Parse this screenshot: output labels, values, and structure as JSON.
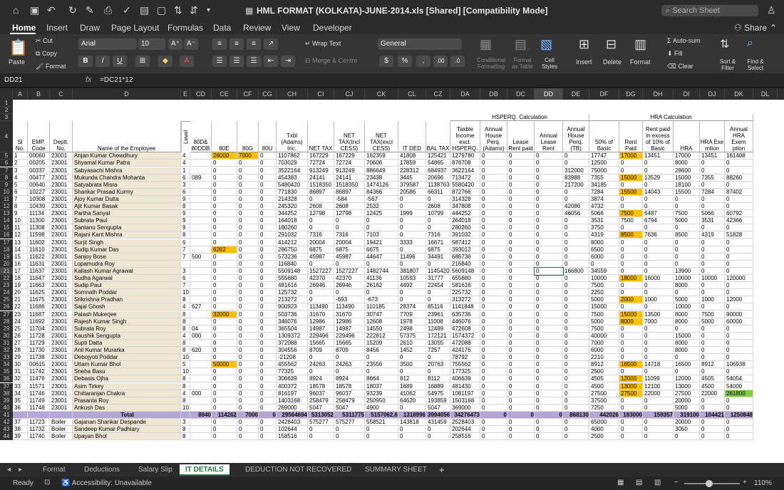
{
  "window": {
    "title": "HML FORMAT (KOLKATA)-JUNE-2014.xls  [Shared]  [Compatibility Mode]",
    "search_placeholder": "Search Sheet",
    "share": "Share"
  },
  "menu": [
    "Home",
    "Insert",
    "Draw",
    "Page Layout",
    "Formulas",
    "Data",
    "Review",
    "View",
    "Developer"
  ],
  "ribbon": {
    "paste": "Paste",
    "cut": "Cut",
    "copy": "Copy",
    "format": "Format",
    "font": "Arial",
    "size": "10",
    "wrap": "Wrap Text",
    "merge": "Merge & Centre",
    "numfmt": "General",
    "cond": "Conditional Formatting",
    "fmt_table": "Format as Table",
    "cell_styles": "Cell Styles",
    "insert": "Insert",
    "delete": "Delete",
    "format2": "Format",
    "autosum": "Auto-sum",
    "fill": "Fill",
    "clear": "Clear",
    "sort": "Sort & Filter",
    "find": "Find & Select",
    "bold": "B",
    "italic": "I",
    "underline": "U"
  },
  "formula": {
    "cell": "DD21",
    "fx": "fx",
    "text": "=DC21*12"
  },
  "columns": [
    "A",
    "B",
    "C",
    "D",
    "E",
    "CD",
    "CE",
    "CF",
    "CG",
    "CH",
    "CI",
    "CJ",
    "CK",
    "CL",
    "CZ",
    "DA",
    "DB",
    "DC",
    "DD",
    "DE",
    "DF",
    "DG",
    "DH",
    "DI",
    "DJ",
    "DK",
    "DL"
  ],
  "group_headers": {
    "hsperq": "HSPERQ. Calculation",
    "hra": "HRA Calculation"
  },
  "headers": [
    "Sl No.",
    "EMP. Code",
    "Deptt. No.",
    "Name of the Employee",
    "Level",
    "80D& 80DDB",
    "80E",
    "80G",
    "80U",
    "Txbl (Adams) Inc.",
    "NET TAX",
    "NET TAX(Incl CESS)",
    "NET TAX(excl CESS)",
    "IT DED",
    "BAL TAX",
    "Taxble Income excl. HSPERQ.",
    "Annual House Perq. (Adams)",
    "Lease Rent paid",
    "Annual Lease Rent",
    "Annual House Perq. (TB)",
    "50% of Basic",
    "Rent Paid",
    "Rent paid in excess of 10% of Basic",
    "HRA",
    "HRA Exe mtion",
    "Annual HRA Exem ption"
  ],
  "rows": [
    [
      "1",
      "00060",
      "23001",
      "Anjan Kumar Chowdhury",
      "4",
      "",
      "26000",
      "7000",
      "0",
      "1107862",
      "167229",
      "167229",
      "162359",
      "41808",
      "125421",
      "1279780",
      "0",
      "0",
      "0",
      "0",
      "17747",
      "17000",
      "13451",
      "17000",
      "13451",
      "161408"
    ],
    [
      "2",
      "00205",
      "23001",
      "Shyamal Kumar Patra",
      "4",
      "",
      "0",
      "0",
      "0",
      "703029",
      "72724",
      "72724",
      "70606",
      "17859",
      "54865",
      "876708",
      "0",
      "0",
      "0",
      "0",
      "12500",
      "0",
      "0",
      "8000",
      "0",
      "0"
    ],
    [
      "3",
      "00337",
      "23001",
      "Sabyasachi Mishra",
      "1",
      "",
      "0",
      "0",
      "0",
      "3522164",
      "913249",
      "913249",
      "886649",
      "228312",
      "684937",
      "3622164",
      "0",
      "0",
      "0",
      "312000",
      "75000",
      "0",
      "0",
      "28600",
      "0",
      "0"
    ],
    [
      "4",
      "00477",
      "23001",
      "Mukunda Chandra Mohanta",
      "6",
      "089",
      "0",
      "0",
      "0",
      "454383",
      "24141",
      "24141",
      "23438",
      "3445",
      "20696",
      "713472",
      "0",
      "0",
      "0",
      "83988",
      "7355",
      "15000",
      "13529",
      "15000",
      "7355",
      "88260"
    ],
    [
      "5",
      "00640",
      "23001",
      "Satyabrata Misra",
      "3",
      "",
      "0",
      "0",
      "0",
      "5480420",
      "1518350",
      "1518350",
      "1474126",
      "379587",
      "1138763",
      "5580420",
      "0",
      "0",
      "0",
      "217200",
      "34185",
      "0",
      "0",
      "18100",
      "0",
      "0"
    ],
    [
      "6",
      "10227",
      "23001",
      "Shankar Prasad Kurmy",
      "6",
      "",
      "0",
      "0",
      "0",
      "771830",
      "86897",
      "86897",
      "84366",
      "20586",
      "66311",
      "872766",
      "0",
      "0",
      "0",
      "0",
      "7284",
      "15500",
      "14043",
      "15500",
      "7284",
      "87402"
    ],
    [
      "7",
      "10308",
      "23001",
      "Ajoy Kumar Dutta",
      "9",
      "",
      "0",
      "0",
      "0",
      "214328",
      "0",
      "-584",
      "-567",
      "0",
      "0",
      "314328",
      "0",
      "0",
      "0",
      "0",
      "3874",
      "0",
      "0",
      "0",
      "0",
      "0"
    ],
    [
      "8",
      "10439",
      "23001",
      "Ajit Kumar Basak",
      "8",
      "",
      "0",
      "0",
      "0",
      "245320",
      "2608",
      "2608",
      "2532",
      "0",
      "2608",
      "347808",
      "0",
      "0",
      "0",
      "42086",
      "4732",
      "0",
      "0",
      "0",
      "0",
      "0"
    ],
    [
      "9",
      "11134",
      "23001",
      "Partha Sanyal",
      "9",
      "",
      "0",
      "0",
      "0",
      "344252",
      "12798",
      "12798",
      "12425",
      "1999",
      "10799",
      "444252",
      "0",
      "0",
      "0",
      "46056",
      "5066",
      "7500",
      "6487",
      "7500",
      "5066",
      "60792"
    ],
    [
      "10",
      "11300",
      "23001",
      "Subrata Paul",
      "9",
      "",
      "0",
      "0",
      "0",
      "164018",
      "0",
      "0",
      "0",
      "0",
      "0",
      "264018",
      "0",
      "0",
      "0",
      "0",
      "3531",
      "7500",
      "6794",
      "5000",
      "3531",
      "42366"
    ],
    [
      "11",
      "11308",
      "23001",
      "Santanu Sengupta",
      "9",
      "",
      "0",
      "0",
      "0",
      "180260",
      "0",
      "0",
      "0",
      "0",
      "0",
      "280260",
      "0",
      "0",
      "0",
      "0",
      "3750",
      "0",
      "0",
      "0",
      "0",
      "0"
    ],
    [
      "12",
      "11598",
      "23001",
      "Rajani Kant Mishra",
      "8",
      "",
      "0",
      "0",
      "0",
      "291032",
      "7316",
      "7316",
      "7103",
      "0",
      "7316",
      "391032",
      "0",
      "0",
      "0",
      "0",
      "4319",
      "8500",
      "7636",
      "8500",
      "4319",
      "51828"
    ],
    [
      "13",
      "11602",
      "23001",
      "Surjit Singh",
      "6",
      "",
      "0",
      "0",
      "0",
      "414212",
      "20004",
      "20004",
      "19421",
      "3333",
      "16671",
      "587412",
      "0",
      "0",
      "0",
      "0",
      "8000",
      "0",
      "0",
      "0",
      "0",
      "0"
    ],
    [
      "14",
      "11610",
      "23001",
      "Sudip Kumar Das",
      "7",
      "",
      "6262",
      "0",
      "0",
      "286750",
      "6875",
      "6875",
      "6675",
      "0",
      "6875",
      "393012",
      "0",
      "0",
      "0",
      "0",
      "6500",
      "0",
      "0",
      "0",
      "0",
      "0"
    ],
    [
      "15",
      "11622",
      "23001",
      "Sanjoy Bose",
      "7",
      "500",
      "0",
      "0",
      "0",
      "573236",
      "45987",
      "45987",
      "44647",
      "11496",
      "34491",
      "686736",
      "0",
      "0",
      "0",
      "0",
      "6000",
      "0",
      "0",
      "0",
      "0",
      "0"
    ],
    [
      "16",
      "11631",
      "23001",
      "Lopamudra Roy",
      "",
      "",
      "0",
      "0",
      "0",
      "116840",
      "0",
      "0",
      "0",
      "0",
      "0",
      "216840",
      "0",
      "0",
      "0",
      "0",
      "0",
      "0",
      "0",
      "0",
      "0",
      "0"
    ],
    [
      "17",
      "11637",
      "23001",
      "Kailash Kumar Agrawal",
      "3",
      "",
      "0",
      "0",
      "0",
      "5509148",
      "1527227",
      "1527227",
      "1482744",
      "381807",
      "1145420",
      "5609148",
      "0",
      "0",
      "0",
      "166800",
      "34559",
      "0",
      "0",
      "13900",
      "0",
      "0"
    ],
    [
      "18",
      "11647",
      "23001",
      "Sudha Agarwal",
      "6",
      "",
      "0",
      "0",
      "0",
      "555680",
      "42370",
      "42370",
      "41136",
      "10593",
      "31777",
      "655680",
      "0",
      "0",
      "0",
      "0",
      "10000",
      "18000",
      "16000",
      "10000",
      "10000",
      "120000"
    ],
    [
      "19",
      "11663",
      "23001",
      "Sudip Paul",
      "7",
      "",
      "0",
      "0",
      "0",
      "481616",
      "26946",
      "26946",
      "26162",
      "4492",
      "22454",
      "581616",
      "0",
      "0",
      "0",
      "0",
      "7500",
      "0",
      "0",
      "8000",
      "0",
      "0"
    ],
    [
      "20",
      "11625",
      "23001",
      "Somnath Poddar",
      "10",
      "",
      "0",
      "0",
      "0",
      "125732",
      "0",
      "0",
      "0",
      "0",
      "0",
      "225732",
      "0",
      "0",
      "0",
      "0",
      "2250",
      "0",
      "0",
      "0",
      "0",
      "0"
    ],
    [
      "21",
      "11675",
      "23001",
      "Srikrishna Pradhan",
      "8",
      "",
      "0",
      "0",
      "0",
      "213272",
      "0",
      "-693",
      "-673",
      "0",
      "0",
      "313272",
      "0",
      "0",
      "0",
      "0",
      "5000",
      "2000",
      "1000",
      "5000",
      "1000",
      "12000"
    ],
    [
      "22",
      "11686",
      "23001",
      "Sajal Ghosh",
      "4",
      "627",
      "0",
      "0",
      "0",
      "900923",
      "113490",
      "113490",
      "110185",
      "28374",
      "85116",
      "1141848",
      "0",
      "0",
      "0",
      "0",
      "15000",
      "0",
      "0",
      "10000",
      "0",
      "0"
    ],
    [
      "23",
      "11687",
      "23001",
      "Palash Mukerjee",
      "8",
      "",
      "32000",
      "0",
      "0",
      "503736",
      "31670",
      "31670",
      "30747",
      "7709",
      "23961",
      "635736",
      "0",
      "0",
      "0",
      "0",
      "7500",
      "15000",
      "13500",
      "8000",
      "7500",
      "90000"
    ],
    [
      "24",
      "11692",
      "23001",
      "Rajesh Kumar Singh",
      "8",
      "",
      "0",
      "0",
      "0",
      "346076",
      "12986",
      "12986",
      "12608",
      "1978",
      "11008",
      "446076",
      "0",
      "0",
      "0",
      "0",
      "5000",
      "8000",
      "7000",
      "8000",
      "5000",
      "60000"
    ],
    [
      "25",
      "11704",
      "23001",
      "Subrata Roy",
      "8",
      "04",
      "0",
      "0",
      "0",
      "365504",
      "14987",
      "14987",
      "14550",
      "2498",
      "12489",
      "472608",
      "0",
      "0",
      "0",
      "0",
      "7500",
      "0",
      "0",
      "0",
      "0",
      "0"
    ],
    [
      "26",
      "11728",
      "23001",
      "Kaushik Sengupta",
      "4",
      "000",
      "0",
      "0",
      "0",
      "1309372",
      "229496",
      "229496",
      "222812",
      "57375",
      "172121",
      "1574372",
      "0",
      "0",
      "0",
      "0",
      "40000",
      "0",
      "0",
      "15000",
      "0",
      "0"
    ],
    [
      "27",
      "11729",
      "23001",
      "Supti Datta",
      "8",
      "",
      "0",
      "0",
      "0",
      "372088",
      "15665",
      "15665",
      "15209",
      "2610",
      "13055",
      "472088",
      "0",
      "0",
      "0",
      "0",
      "7000",
      "0",
      "0",
      "8000",
      "0",
      "0"
    ],
    [
      "28",
      "11730",
      "23001",
      "Anil Kumar Murarka",
      "8",
      "620",
      "0",
      "0",
      "0",
      "304556",
      "8709",
      "8709",
      "8456",
      "1452",
      "7257",
      "424176",
      "0",
      "0",
      "0",
      "0",
      "6000",
      "0",
      "0",
      "8000",
      "0",
      "0"
    ],
    [
      "29",
      "11738",
      "23001",
      "Debojyoti Poddar",
      "10",
      "",
      "0",
      "0",
      "0",
      "-21208",
      "0",
      "0",
      "0",
      "0",
      "0",
      "78792",
      "0",
      "0",
      "0",
      "0",
      "2210",
      "0",
      "0",
      "0",
      "0",
      "0"
    ],
    [
      "30",
      "00615",
      "23001",
      "Uttam Kumar Bhol",
      "5",
      "",
      "50000",
      "0",
      "0",
      "455562",
      "24263",
      "24263",
      "23556",
      "3500",
      "20763",
      "755562",
      "0",
      "0",
      "0",
      "0",
      "8912",
      "16500",
      "14718",
      "16500",
      "8912",
      "106938"
    ],
    [
      "31",
      "11742",
      "23001",
      "Sneha Basu",
      "10",
      "",
      "0",
      "0",
      "0",
      "77325",
      "0",
      "0",
      "0",
      "0",
      "0",
      "177325",
      "0",
      "0",
      "0",
      "0",
      "2500",
      "0",
      "0",
      "0",
      "0",
      "0"
    ],
    [
      "32",
      "11476",
      "23001",
      "Debasis Ojha",
      "8",
      "",
      "0",
      "0",
      "0",
      "306639",
      "8924",
      "8924",
      "8664",
      "812",
      "8112",
      "406639",
      "0",
      "0",
      "0",
      "0",
      "4505",
      "12000",
      "11099",
      "12000",
      "4505",
      "54054"
    ],
    [
      "33",
      "11571",
      "23001",
      "Asim Tirkey",
      "8",
      "",
      "0",
      "0",
      "0",
      "400372",
      "18578",
      "18578",
      "18037",
      "1689",
      "16889",
      "481430",
      "0",
      "0",
      "0",
      "0",
      "4500",
      "13000",
      "12100",
      "13000",
      "4500",
      "54000"
    ],
    [
      "34",
      "11746",
      "23001",
      "Chittaranjan Chakra",
      "4",
      "000",
      "0",
      "0",
      "0",
      "816197",
      "96037",
      "96037",
      "93239",
      "41062",
      "54975",
      "1081197",
      "0",
      "0",
      "0",
      "0",
      "27500",
      "27500",
      "22000",
      "27500",
      "22000",
      "261800"
    ],
    [
      "35",
      "11749",
      "23001",
      "Prasanta Roy",
      "8",
      "",
      "0",
      "0",
      "0",
      "1403168",
      "258479",
      "258479",
      "250950",
      "64620",
      "193859",
      "1503168",
      "0",
      "0",
      "0",
      "0",
      "37500",
      "0",
      "0",
      "20000",
      "0",
      "0"
    ],
    [
      "36",
      "11748",
      "23001",
      "Ankush Das",
      "10",
      "",
      "0",
      "0",
      "0",
      "269000",
      "5047",
      "5047",
      "4900",
      "0",
      "5047",
      "369000",
      "0",
      "0",
      "0",
      "0",
      "7250",
      "0",
      "0",
      "5000",
      "0",
      "0"
    ]
  ],
  "total_row": [
    "",
    "",
    "",
    "Total",
    "",
    "8940",
    "114262",
    "7000",
    "0",
    "29564694",
    "5313052",
    "5311775",
    "5157062.6",
    "1318996",
    "3994056",
    "34276473",
    "0",
    "0",
    "0",
    "868130",
    "442026",
    "183000",
    "159357",
    "319100",
    "104421",
    "1250848"
  ],
  "rows_after": [
    [
      "37",
      "11723",
      "Boiler",
      "Gajanan Shankar Despande",
      "3",
      "",
      "0",
      "0",
      "0",
      "2428403",
      "575277",
      "575277",
      "558521",
      "143818",
      "431459",
      "2528403",
      "0",
      "0",
      "0",
      "0",
      "65000",
      "0",
      "0",
      "20000",
      "0",
      "0"
    ],
    [
      "38",
      "11732",
      "Boiler",
      "Sandeep Kumar Padhiary",
      "8",
      "",
      "0",
      "0",
      "0",
      "102644",
      "0",
      "0",
      "0",
      "0",
      "0",
      "202644",
      "0",
      "0",
      "0",
      "0",
      "4000",
      "0",
      "0",
      "3050",
      "0",
      "0"
    ],
    [
      "39",
      "11740",
      "Boiler",
      "Upayan Bhol",
      "8",
      "",
      "0",
      "0",
      "0",
      "158516",
      "0",
      "0",
      "0",
      "0",
      "0",
      "258516",
      "0",
      "0",
      "0",
      "0",
      "2500",
      "0",
      "0",
      "0",
      "0",
      "0"
    ]
  ],
  "sheet_tabs": [
    "Format",
    "Deductions",
    "Salary Slip",
    "IT DETAILS",
    "DEDUCTION NOT RECOVERED",
    "SUMMARY SHEET"
  ],
  "active_tab": "IT DETAILS",
  "status": {
    "ready": "Ready",
    "accessibility": "Accessibility: Unavailable",
    "zoom": "110%"
  }
}
